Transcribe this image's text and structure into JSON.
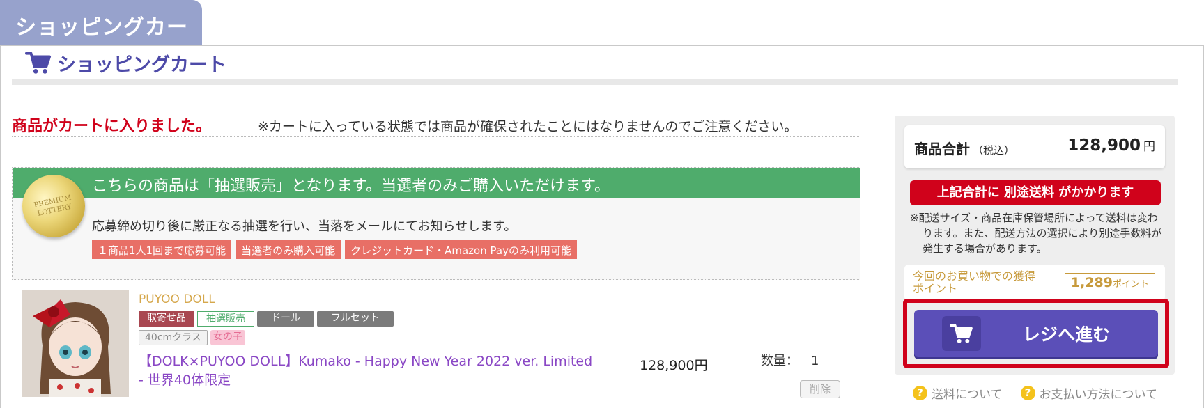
{
  "tab_header": "ショッピングカート",
  "page_title": "ショッピングカート",
  "added_message": "商品がカートに入りました。",
  "notice": "※カートに入っている状態では商品が確保されたことにはなりませんのでご注意ください。",
  "lottery": {
    "heading": "こちらの商品は「抽選販売」となります。当選者のみご購入いただけます。",
    "medal_text": "PREMIUM LOTTERY",
    "description": "応募締め切り後に厳正なる抽選を行い、当落をメールにてお知らせします。",
    "tags": [
      "１商品1人1回まで応募可能",
      "当選者のみ購入可能",
      "クレジットカード・Amazon Payのみ利用可能"
    ]
  },
  "product": {
    "brand": "PUYOO DOLL",
    "tags_row1": [
      "取寄せ品",
      "抽選販売",
      "ドール",
      "フルセット"
    ],
    "size_tag": "40cmクラス",
    "gender_tag": "女の子",
    "name": "【DOLK×PUYOO DOLL】Kumako - Happy New Year 2022 ver. Limited - 世界40体限定",
    "price": "128,900円",
    "quantity_label": "数量：",
    "quantity": "1",
    "delete_label": "削除"
  },
  "summary": {
    "total_label": "商品合計",
    "tax_label": "（税込）",
    "total_value": "128,900",
    "currency": "円",
    "shipping_banner": "上記合計に 別途送料 がかかります",
    "shipping_note": "※配送サイズ・商品在庫保管場所によって送料は変わります。また、配送方法の選択により別途手数料が発生する場合があります。",
    "points_label": "今回のお買い物での獲得ポイント",
    "points_value": "1,289",
    "points_unit": "ポイント",
    "checkout_label": "レジへ進む"
  },
  "help_links": [
    "送料について",
    "お支払い方法について"
  ],
  "colors": {
    "brand_purple": "#5b4fb8",
    "alert_red": "#d0021b",
    "lottery_green": "#4fac6c",
    "point_gold": "#c79a3b"
  },
  "icons": [
    "cart-icon",
    "lottery-medal-icon",
    "help-icon"
  ]
}
